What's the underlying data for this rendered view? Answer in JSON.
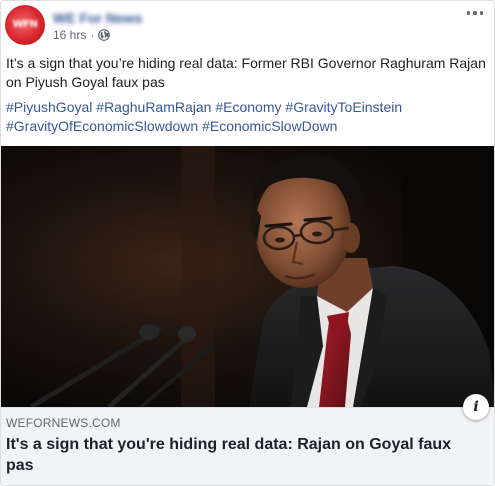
{
  "page": {
    "name": "WE For News",
    "avatar_text": "WFN",
    "timestamp": "16 hrs",
    "separator": "·",
    "privacy_icon": "globe-icon",
    "more_icon": "more-options-icon"
  },
  "post": {
    "text": "It’s a sign that you’re hiding real data: Former RBI Governor Raghuram Rajan on Piyush Goyal faux pas",
    "hashtags": [
      "#PiyushGoyal",
      "#RaghuRamRajan",
      "#Economy",
      "#GravityToEinstein",
      "#GravityOfEconomicSlowdown",
      "#EconomicSlowDown"
    ]
  },
  "link_preview": {
    "domain": "WEFORNEWS.COM",
    "title": "It's a sign that you're hiding real data: Rajan on Goyal faux pas",
    "info_label": "i"
  },
  "colors": {
    "link": "#385898",
    "meta": "#616770",
    "footer_bg": "#f2f3f5",
    "avatar": "#d9262d"
  }
}
